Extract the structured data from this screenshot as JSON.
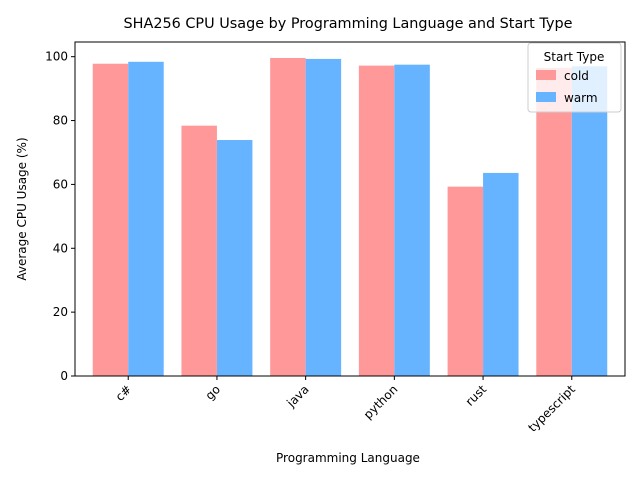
{
  "chart_data": {
    "type": "bar",
    "title": "SHA256 CPU Usage by Programming Language and Start Type",
    "xlabel": "Programming Language",
    "ylabel": "Average CPU Usage (%)",
    "categories": [
      "c#",
      "go",
      "java",
      "python",
      "rust",
      "typescript"
    ],
    "series": [
      {
        "name": "cold",
        "color": "#ff9999",
        "values": [
          97.8,
          78.4,
          99.6,
          97.2,
          59.3,
          96.5
        ]
      },
      {
        "name": "warm",
        "color": "#66b3ff",
        "values": [
          98.4,
          73.9,
          99.3,
          97.5,
          63.6,
          97.0
        ]
      }
    ],
    "ylim": [
      0,
      104.6
    ],
    "yticks": [
      0,
      20,
      40,
      60,
      80,
      100
    ],
    "grid": false,
    "legend": {
      "title": "Start Type",
      "placement": "top-right"
    },
    "xtick_rotation": 45
  }
}
